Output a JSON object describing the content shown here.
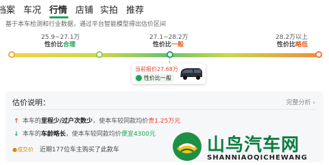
{
  "tabs": [
    "档案",
    "车况",
    "行情",
    "店铺",
    "实拍",
    "推荐"
  ],
  "subtitle": "基于本车检测和行业数据，通过平台智能模型得出估价区间",
  "scale": [
    {
      "range": "25.9~27.1万",
      "prefix": "性价比",
      "verdict": "合理"
    },
    {
      "range": "27.1~28.2万",
      "prefix": "性价比",
      "verdict": "一般"
    },
    {
      "range": "28.2万以上",
      "prefix": "性价比",
      "verdict": "略低"
    }
  ],
  "card": {
    "price_label": "当前报价27.68万",
    "badge": "性价比一般"
  },
  "panel": {
    "title": "估价说明：",
    "link": "完整分析 ›",
    "reasons": [
      {
        "arrow": "↑",
        "pre": "本车的",
        "bold": "里程少/过户次数少",
        "mid": "，使本车较同款均价",
        "value": "贵1.25万元"
      },
      {
        "arrow": "↓",
        "pre": "本车的",
        "bold": "车龄略长",
        "mid": "，使本车较同款均价",
        "value": "便宜4300元"
      }
    ],
    "deal_badge": "●成交价",
    "deal_text": "近期177位车主购买了此款车"
  },
  "watermark": {
    "cn": "山鸟汽车网",
    "en": "SHANNIAOQICHEWANG"
  },
  "colors": {
    "accent": "#1fa35a",
    "warn": "#e6402e",
    "orange": "#e65c1e"
  }
}
